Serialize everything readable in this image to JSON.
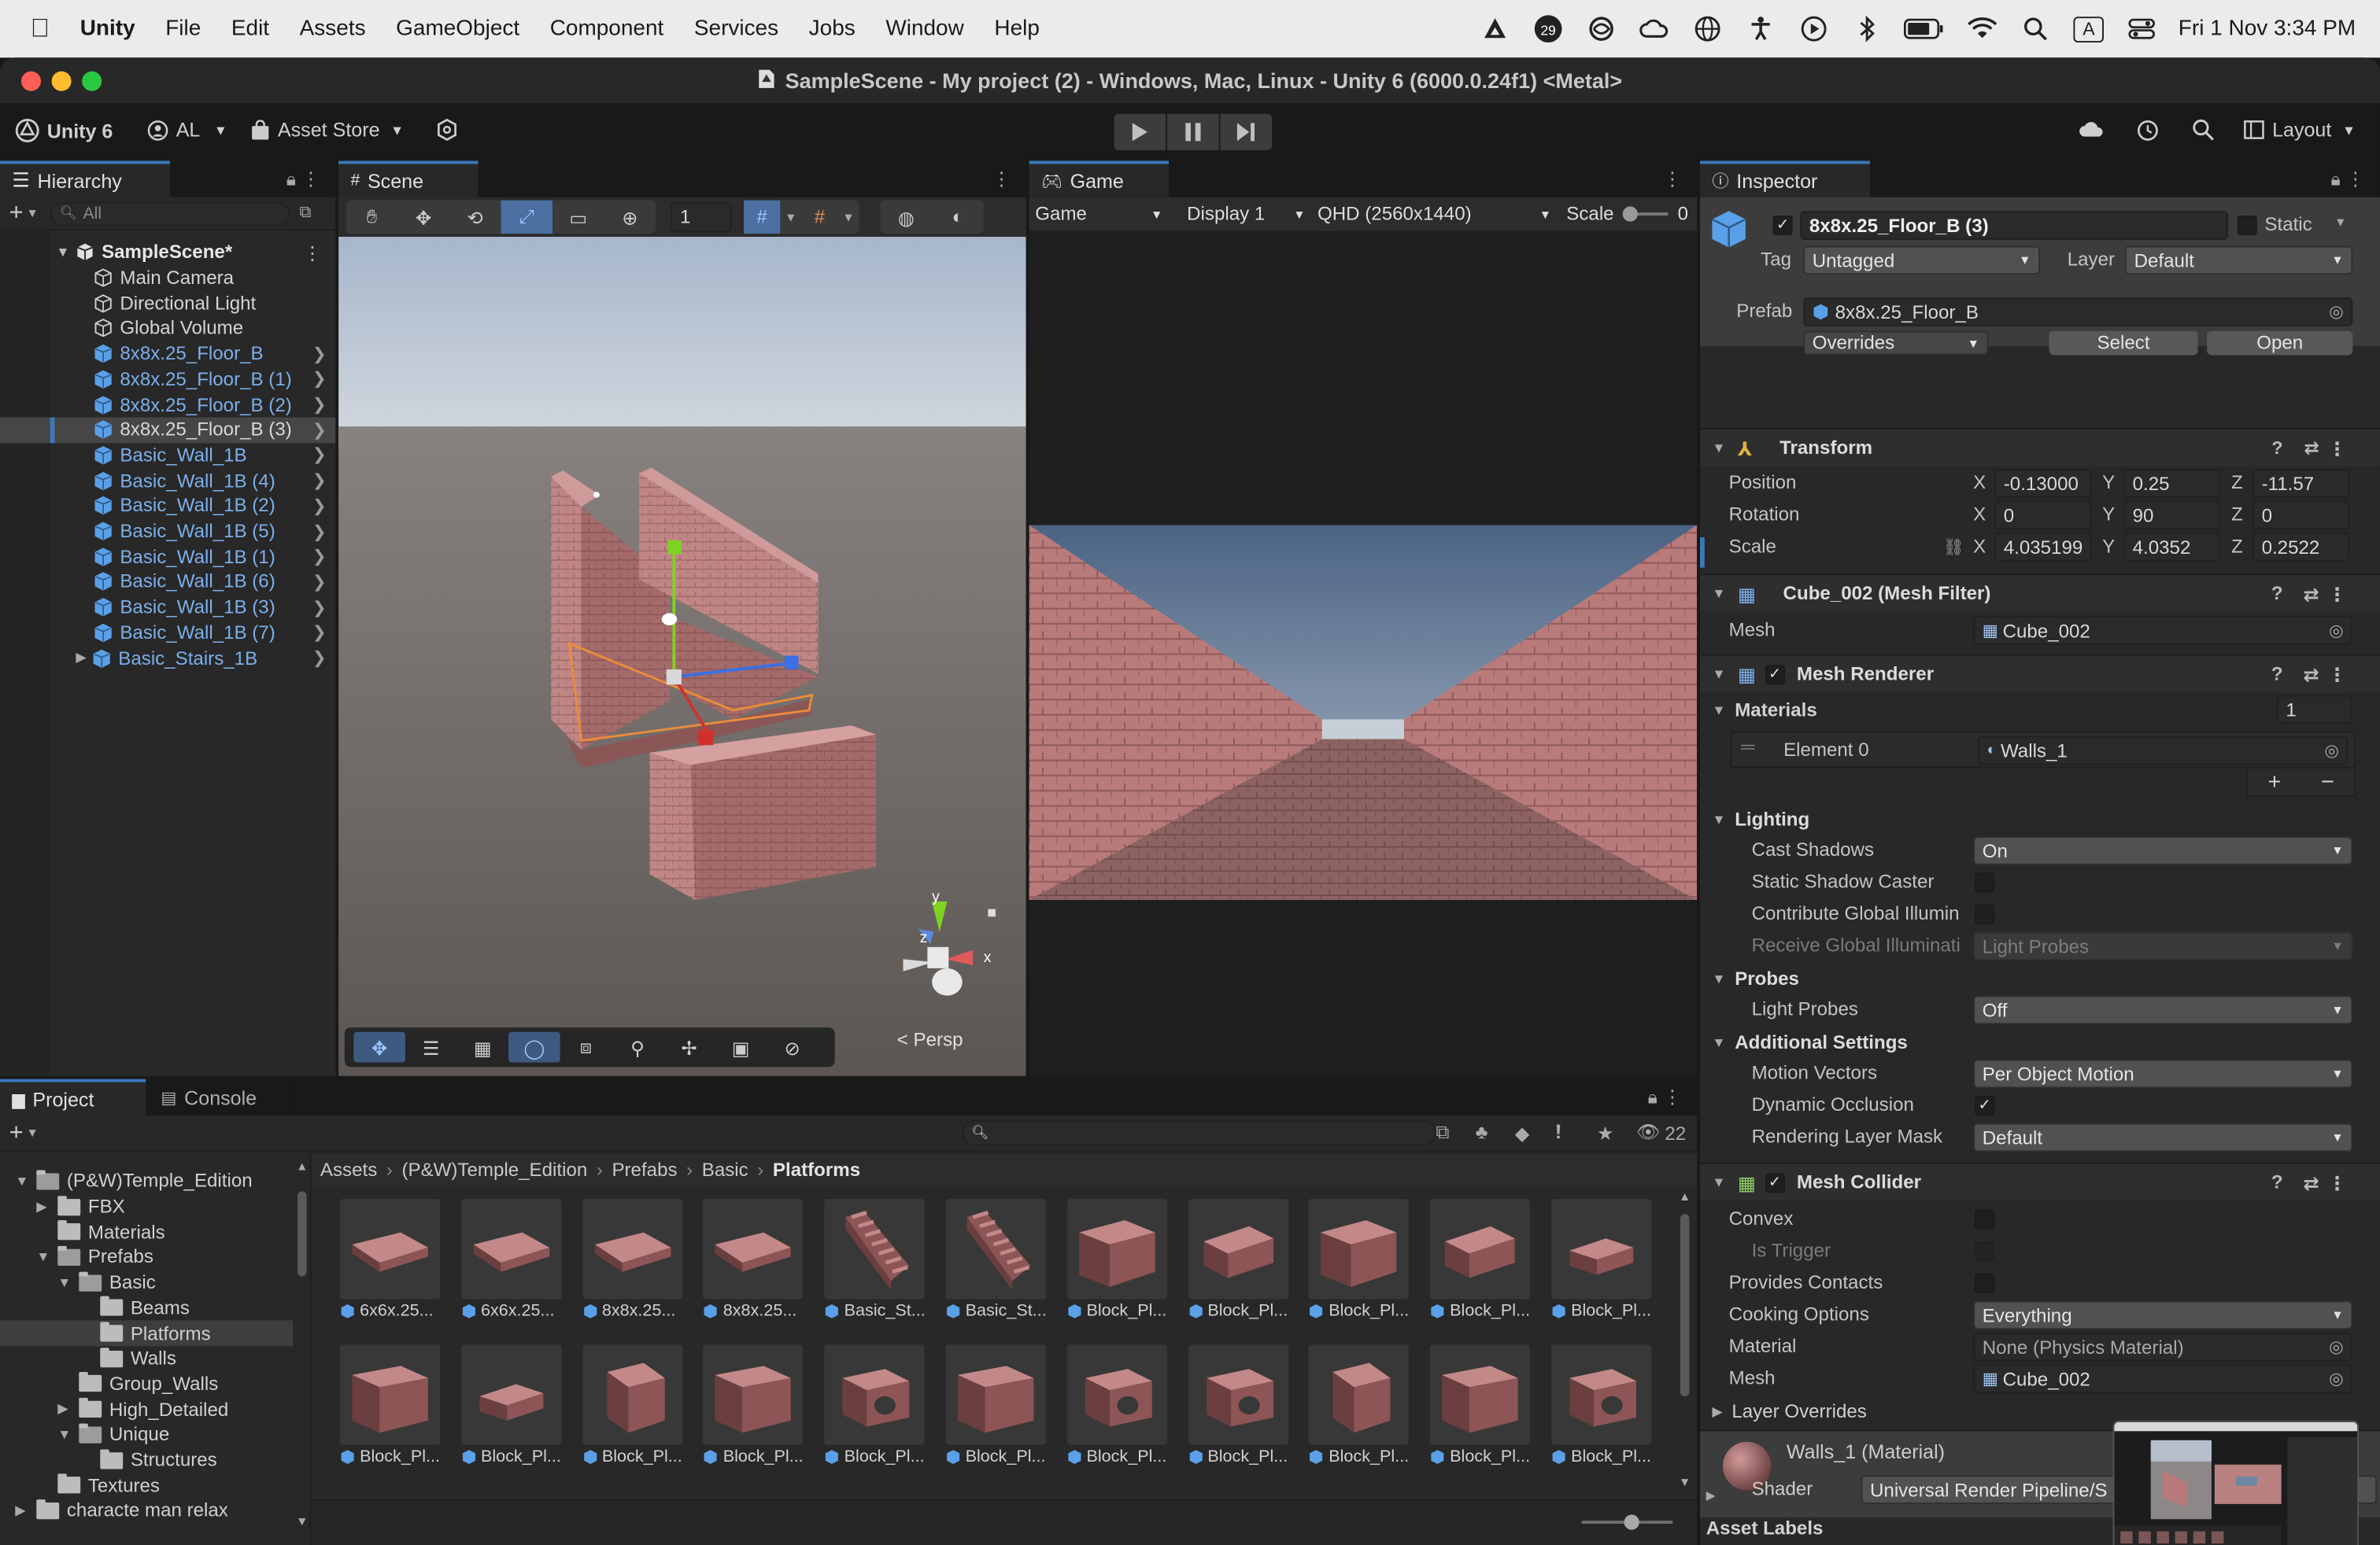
{
  "menubar": {
    "app": "Unity",
    "items": [
      "File",
      "Edit",
      "Assets",
      "GameObject",
      "Component",
      "Services",
      "Jobs",
      "Window",
      "Help"
    ],
    "notif_badge": "29",
    "input_badge": "A",
    "datetime": "Fri 1 Nov  3:34 PM"
  },
  "window": {
    "title": "SampleScene - My project (2) - Windows, Mac, Linux - Unity 6 (6000.0.24f1) <Metal>"
  },
  "toolbar": {
    "unity_version": "Unity 6",
    "account": "AL",
    "asset_store": "Asset Store",
    "layout": "Layout"
  },
  "hierarchy": {
    "tab": "Hierarchy",
    "search_placeholder": "All",
    "scene": "SampleScene*",
    "items": [
      {
        "label": "Main Camera",
        "prefab": false
      },
      {
        "label": "Directional Light",
        "prefab": false
      },
      {
        "label": "Global Volume",
        "prefab": false
      },
      {
        "label": "8x8x.25_Floor_B",
        "prefab": true
      },
      {
        "label": "8x8x.25_Floor_B (1)",
        "prefab": true
      },
      {
        "label": "8x8x.25_Floor_B (2)",
        "prefab": true
      },
      {
        "label": "8x8x.25_Floor_B (3)",
        "prefab": true,
        "selected": true
      },
      {
        "label": "Basic_Wall_1B",
        "prefab": true
      },
      {
        "label": "Basic_Wall_1B (4)",
        "prefab": true
      },
      {
        "label": "Basic_Wall_1B (2)",
        "prefab": true
      },
      {
        "label": "Basic_Wall_1B (5)",
        "prefab": true
      },
      {
        "label": "Basic_Wall_1B (1)",
        "prefab": true
      },
      {
        "label": "Basic_Wall_1B (6)",
        "prefab": true
      },
      {
        "label": "Basic_Wall_1B (3)",
        "prefab": true
      },
      {
        "label": "Basic_Wall_1B (7)",
        "prefab": true
      },
      {
        "label": "Basic_Stairs_1B",
        "prefab": true
      }
    ]
  },
  "scene_view": {
    "tab": "Scene",
    "grid_value": "1",
    "persp_label": "< Persp",
    "gizmo_y": "y",
    "gizmo_x": "x",
    "gizmo_z": "z"
  },
  "game_view": {
    "tab": "Game",
    "mode": "Game",
    "display": "Display 1",
    "resolution": "QHD (2560x1440)",
    "scale_label": "Scale",
    "scale_value": "0"
  },
  "inspector": {
    "tab": "Inspector",
    "object_name": "8x8x.25_Floor_B (3)",
    "static_label": "Static",
    "tag_label": "Tag",
    "tag_value": "Untagged",
    "layer_label": "Layer",
    "layer_value": "Default",
    "prefab_label": "Prefab",
    "prefab_value": "8x8x.25_Floor_B",
    "overrides": "Overrides",
    "select": "Select",
    "open": "Open",
    "transform": {
      "title": "Transform",
      "position_label": "Position",
      "rotation_label": "Rotation",
      "scale_label": "Scale",
      "position": [
        "-0.13000",
        "0.25",
        "-11.57"
      ],
      "rotation": [
        "0",
        "90",
        "0"
      ],
      "scale": [
        "4.035199",
        "4.0352",
        "0.2522"
      ],
      "axes": [
        "X",
        "Y",
        "Z"
      ]
    },
    "mesh_filter": {
      "title": "Cube_002 (Mesh Filter)",
      "mesh_label": "Mesh",
      "mesh_value": "Cube_002"
    },
    "mesh_renderer": {
      "title": "Mesh Renderer",
      "materials_label": "Materials",
      "materials_count": "1",
      "element0_label": "Element 0",
      "element0_value": "Walls_1",
      "plus": "+",
      "minus": "−",
      "lighting_label": "Lighting",
      "cast_shadows_label": "Cast Shadows",
      "cast_shadows_value": "On",
      "static_shadow_label": "Static Shadow Caster",
      "contribute_gi_label": "Contribute Global Illumin",
      "receive_gi_label": "Receive Global Illuminati",
      "receive_gi_value": "Light Probes",
      "probes_label": "Probes",
      "light_probes_label": "Light Probes",
      "light_probes_value": "Off",
      "additional_label": "Additional Settings",
      "motion_vectors_label": "Motion Vectors",
      "motion_vectors_value": "Per Object Motion",
      "dynamic_occlusion_label": "Dynamic Occlusion",
      "rendering_layer_label": "Rendering Layer Mask",
      "rendering_layer_value": "Default"
    },
    "mesh_collider": {
      "title": "Mesh Collider",
      "convex_label": "Convex",
      "is_trigger_label": "Is Trigger",
      "provides_contacts_label": "Provides Contacts",
      "cooking_label": "Cooking Options",
      "cooking_value": "Everything",
      "material_label": "Material",
      "material_value": "None (Physics Material)",
      "mesh_label": "Mesh",
      "mesh_value": "Cube_002",
      "layer_overrides_label": "Layer Overrides"
    },
    "material_preview": {
      "name": "Walls_1 (Material)",
      "shader_label": "Shader",
      "shader_value": "Universal Render Pipeline/S"
    },
    "asset_labels": "Asset Labels"
  },
  "project": {
    "tab_project": "Project",
    "tab_console": "Console",
    "hidden_count": "22",
    "breadcrumb": [
      "Assets",
      "(P&W)Temple_Edition",
      "Prefabs",
      "Basic",
      "Platforms"
    ],
    "tree": [
      {
        "label": "(P&W)Temple_Edition",
        "depth": 0,
        "arrow": "down",
        "open": true
      },
      {
        "label": "FBX",
        "depth": 1,
        "arrow": "right"
      },
      {
        "label": "Materials",
        "depth": 1,
        "arrow": ""
      },
      {
        "label": "Prefabs",
        "depth": 1,
        "arrow": "down",
        "open": true
      },
      {
        "label": "Basic",
        "depth": 2,
        "arrow": "down",
        "open": true
      },
      {
        "label": "Beams",
        "depth": 3,
        "arrow": ""
      },
      {
        "label": "Platforms",
        "depth": 3,
        "arrow": "",
        "selected": true
      },
      {
        "label": "Walls",
        "depth": 3,
        "arrow": ""
      },
      {
        "label": "Group_Walls",
        "depth": 2,
        "arrow": ""
      },
      {
        "label": "High_Detailed",
        "depth": 2,
        "arrow": "right"
      },
      {
        "label": "Unique",
        "depth": 2,
        "arrow": "down",
        "open": true
      },
      {
        "label": "Structures",
        "depth": 3,
        "arrow": ""
      },
      {
        "label": "Textures",
        "depth": 1,
        "arrow": ""
      },
      {
        "label": "characte man relax",
        "depth": 0,
        "arrow": "right"
      }
    ],
    "assets_row1": [
      "6x6x.25...",
      "6x6x.25...",
      "8x8x.25...",
      "8x8x.25...",
      "Basic_St...",
      "Basic_St...",
      "Block_Pl...",
      "Block_Pl...",
      "Block_Pl...",
      "Block_Pl...",
      "Block_Pl..."
    ],
    "assets_row2": [
      "Block_Pl...",
      "Block_Pl...",
      "Block_Pl...",
      "Block_Pl...",
      "Block_Pl...",
      "Block_Pl...",
      "Block_Pl...",
      "Block_Pl...",
      "Block_Pl...",
      "Block_Pl...",
      "Block_Pl..."
    ]
  },
  "colors": {
    "accent": "#3a79bb",
    "prefab_blue": "#7bafea",
    "brick": "#b87a7a",
    "panel": "#282828"
  }
}
